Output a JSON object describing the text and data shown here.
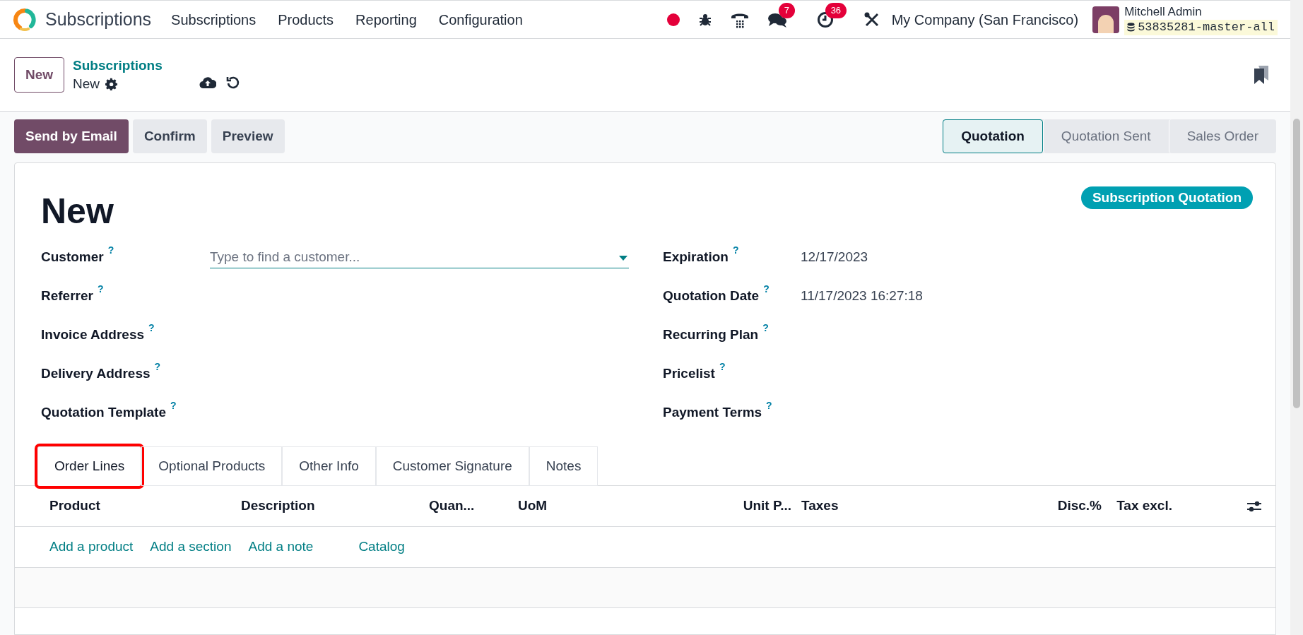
{
  "navbar": {
    "app_name": "Subscriptions",
    "menu": [
      "Subscriptions",
      "Products",
      "Reporting",
      "Configuration"
    ],
    "messages_badge": "7",
    "activities_badge": "36",
    "company": "My Company (San Francisco)",
    "user_name": "Mitchell Admin",
    "database": "53835281-master-all"
  },
  "control_panel": {
    "new_button": "New",
    "breadcrumb": "Subscriptions",
    "current": "New"
  },
  "actions": [
    {
      "label": "Send by Email",
      "primary": true
    },
    {
      "label": "Confirm",
      "primary": false
    },
    {
      "label": "Preview",
      "primary": false
    }
  ],
  "status_stages": [
    {
      "label": "Quotation",
      "selected": true
    },
    {
      "label": "Quotation Sent",
      "selected": false
    },
    {
      "label": "Sales Order",
      "selected": false
    }
  ],
  "form": {
    "title": "New",
    "badge": "Subscription Quotation",
    "left_fields": [
      {
        "label": "Customer",
        "help": "?",
        "kind": "input",
        "placeholder": "Type to find a customer..."
      },
      {
        "label": "Referrer",
        "help": "?",
        "kind": "text"
      },
      {
        "label": "Invoice Address",
        "help": "?",
        "kind": "text"
      },
      {
        "label": "Delivery Address",
        "help": "?",
        "kind": "text"
      },
      {
        "label": "Quotation Template",
        "help": "?",
        "kind": "text"
      }
    ],
    "right_fields": [
      {
        "label": "Expiration",
        "help": "?",
        "kind": "text",
        "value": "12/17/2023"
      },
      {
        "label": "Quotation Date",
        "help": "?",
        "kind": "text",
        "value": "11/17/2023 16:27:18"
      },
      {
        "label": "Recurring Plan",
        "help": "?",
        "kind": "text"
      },
      {
        "label": "Pricelist",
        "help": "?",
        "kind": "text"
      },
      {
        "label": "Payment Terms",
        "help": "?",
        "kind": "text"
      }
    ]
  },
  "tabs": [
    {
      "label": "Order Lines",
      "selected": true,
      "highlighted": true
    },
    {
      "label": "Optional Products",
      "selected": false,
      "highlighted": false
    },
    {
      "label": "Other Info",
      "selected": false,
      "highlighted": false
    },
    {
      "label": "Customer Signature",
      "selected": false,
      "highlighted": false
    },
    {
      "label": "Notes",
      "selected": false,
      "highlighted": false
    }
  ],
  "table": {
    "columns": [
      "Product",
      "Description",
      "Quan...",
      "UoM",
      "Unit P...",
      "Taxes",
      "Disc.%",
      "Tax excl."
    ],
    "add_links": [
      "Add a product",
      "Add a section",
      "Add a note",
      "Catalog"
    ]
  }
}
